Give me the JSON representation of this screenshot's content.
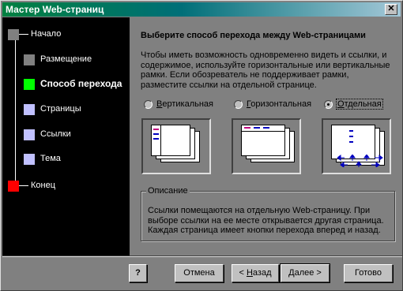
{
  "window": {
    "title": "Мастер Web-страниц",
    "close_glyph": "✕"
  },
  "steps": [
    {
      "label": "Начало",
      "color": "#808080"
    },
    {
      "label": "Размещение",
      "color": "#808080"
    },
    {
      "label": "Способ перехода",
      "color": "#00ff00",
      "current": true
    },
    {
      "label": "Страницы",
      "color": "#c0c0ff"
    },
    {
      "label": "Ссылки",
      "color": "#c0c0ff"
    },
    {
      "label": "Тема",
      "color": "#c0c0ff"
    },
    {
      "label": "Конец",
      "color": "#ff0000"
    }
  ],
  "main": {
    "heading": "Выберите способ перехода между Web-страницами",
    "intro": "Чтобы иметь возможность одновременно видеть и ссылки, и содержимое, используйте горизонтальные или вертикальные рамки.  Если обозреватель не поддерживает рамки, разместите ссылки на отдельной странице.",
    "options": [
      {
        "hotkey": "В",
        "rest": "ертикальная",
        "selected": false
      },
      {
        "hotkey": "Г",
        "rest": "оризонтальная",
        "selected": false
      },
      {
        "hotkey": "О",
        "rest": "тдельная",
        "selected": true
      }
    ],
    "description_legend": "Описание",
    "description": "Ссылки помещаются на отдельную Web-страницу.  При выборе ссылки на ее месте открывается другая страница. Каждая страница имеет кнопки перехода вперед и назад."
  },
  "buttons": {
    "help": "?",
    "cancel": "Отмена",
    "back_prefix": "< ",
    "back_hotkey": "Н",
    "back_rest": "азад",
    "next_prefix": "",
    "next_hotkey": "Д",
    "next_rest": "алее >",
    "finish": "Готово"
  }
}
